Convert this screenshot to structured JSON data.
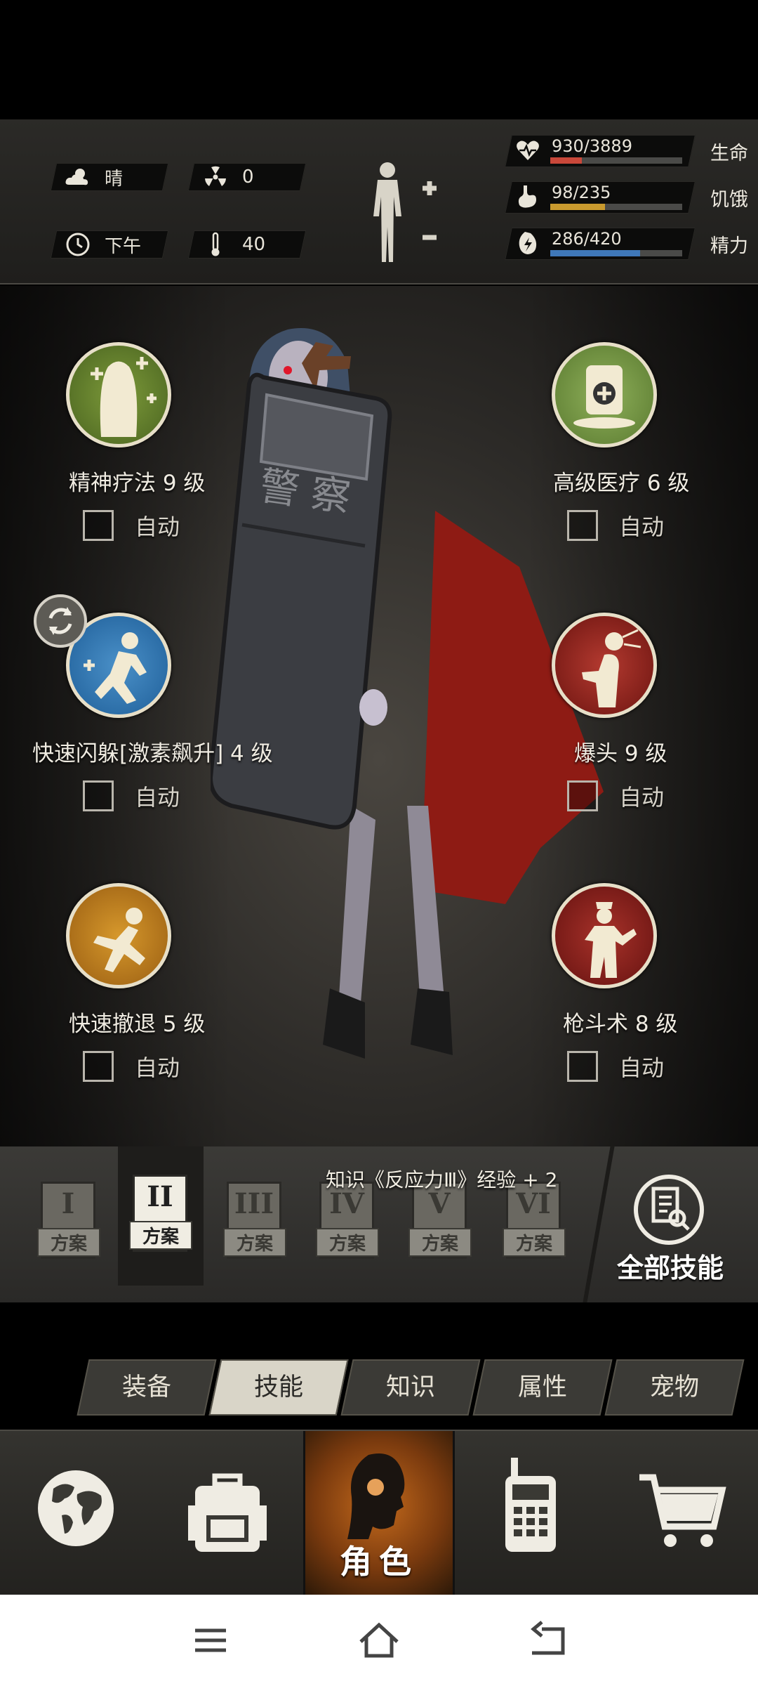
{
  "status": {
    "weather": "晴",
    "radiation": "0",
    "time_of_day": "下午",
    "temperature": "40",
    "vitals": [
      {
        "name": "生命",
        "value": "930/3889",
        "fraction": 0.239,
        "color": "#c9483a",
        "icon": "heart-icon"
      },
      {
        "name": "饥饿",
        "value": "98/235",
        "fraction": 0.417,
        "color": "#c99a2e",
        "icon": "stomach-icon"
      },
      {
        "name": "精力",
        "value": "286/420",
        "fraction": 0.681,
        "color": "#3f78b9",
        "icon": "energy-icon"
      }
    ]
  },
  "skills": [
    {
      "name": "精神疗法 9 级",
      "auto": "自动",
      "checked": false,
      "icon": "psychotherapy-icon"
    },
    {
      "name": "高级医疗 6 级",
      "auto": "自动",
      "checked": false,
      "icon": "medkit-icon"
    },
    {
      "name": "快速闪躲[激素飙升] 4 级",
      "auto": "自动",
      "checked": false,
      "icon": "dodge-icon"
    },
    {
      "name": "爆头 9 级",
      "auto": "自动",
      "checked": false,
      "icon": "headshot-icon"
    },
    {
      "name": "快速撤退 5 级",
      "auto": "自动",
      "checked": false,
      "icon": "retreat-icon"
    },
    {
      "name": "枪斗术 8 级",
      "auto": "自动",
      "checked": false,
      "icon": "gunfight-icon"
    }
  ],
  "plans": {
    "label": "方案",
    "numerals": [
      "I",
      "II",
      "III",
      "IV",
      "V",
      "VI"
    ],
    "selected_index": 1,
    "exp_note": "知识《反应力Ⅲ》经验 + 2",
    "all_skills_label": "全部技能"
  },
  "tabs": [
    {
      "label": "装备",
      "active": false
    },
    {
      "label": "技能",
      "active": true
    },
    {
      "label": "知识",
      "active": false
    },
    {
      "label": "属性",
      "active": false
    },
    {
      "label": "宠物",
      "active": false
    }
  ],
  "bottom_nav": {
    "items": [
      "globe-icon",
      "backpack-icon",
      "character-icon",
      "radio-icon",
      "cart-icon"
    ],
    "active_label": "角色"
  }
}
